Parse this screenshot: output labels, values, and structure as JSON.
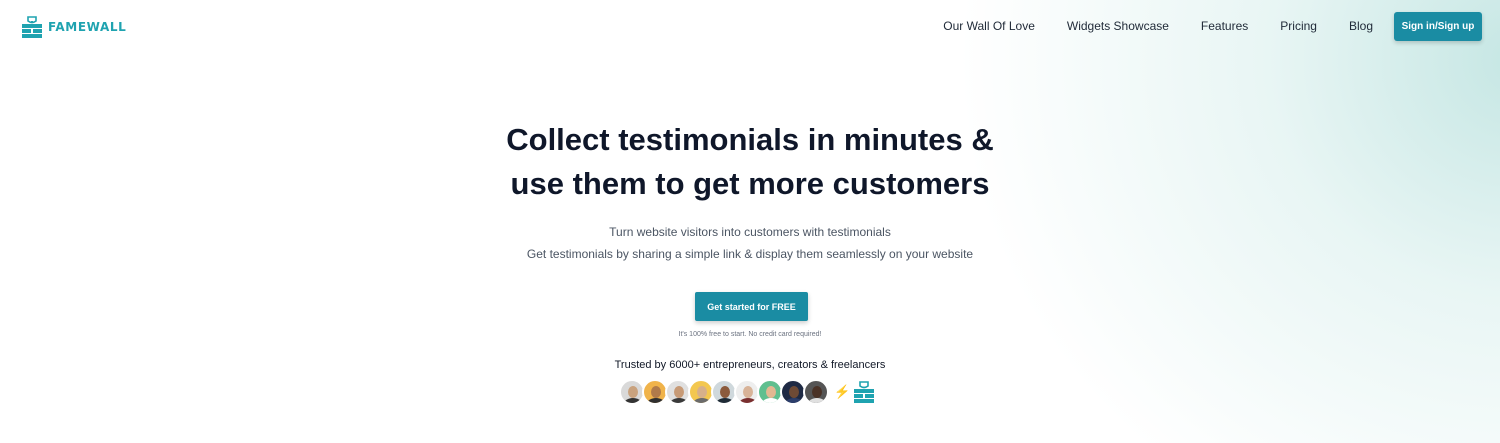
{
  "header": {
    "brand": "FAMEWALL",
    "nav": [
      {
        "label": "Our Wall Of Love"
      },
      {
        "label": "Widgets Showcase"
      },
      {
        "label": "Features"
      },
      {
        "label": "Pricing"
      },
      {
        "label": "Blog"
      }
    ],
    "signin_label": "Sign in/Sign up"
  },
  "hero": {
    "headline_line1": "Collect testimonials in minutes &",
    "headline_line2": "use them to get more customers",
    "sub_line1": "Turn website visitors into customers with testimonials",
    "sub_line2": "Get testimonials by sharing a simple link & display them seamlessly on your website",
    "cta_label": "Get started for FREE",
    "note": "It's 100% free to start. No credit card required!",
    "trusted_text": "Trusted by 6000+ entrepreneurs, creators & freelancers"
  },
  "avatars": [
    {
      "name": "avatar-1",
      "skin": "#c9a27e",
      "bg": "#d9d9d9",
      "shirt": "#333333"
    },
    {
      "name": "avatar-2",
      "skin": "#b07a4a",
      "bg": "#f0b34a",
      "shirt": "#2f2f2f"
    },
    {
      "name": "avatar-3",
      "skin": "#c79a76",
      "bg": "#e0e0e0",
      "shirt": "#3a3a3a"
    },
    {
      "name": "avatar-4",
      "skin": "#d7b08a",
      "bg": "#f3c74f",
      "shirt": "#6b6b6b"
    },
    {
      "name": "avatar-5",
      "skin": "#8b5a3c",
      "bg": "#cfd8dc",
      "shirt": "#1f2b36"
    },
    {
      "name": "avatar-6",
      "skin": "#d8b398",
      "bg": "#eeeeee",
      "shirt": "#7a2f2f"
    },
    {
      "name": "avatar-7",
      "skin": "#e2b892",
      "bg": "#5fbf8f",
      "shirt": "#ffffff"
    },
    {
      "name": "avatar-8",
      "skin": "#6e4a35",
      "bg": "#1f2a44",
      "shirt": "#2c3e6b"
    },
    {
      "name": "avatar-9",
      "skin": "#4a3226",
      "bg": "#555555",
      "shirt": "#e0e0e0"
    }
  ],
  "icons": {
    "bolt": "lightning-bolt-icon",
    "brand_icon": "famewall-logo-icon"
  },
  "colors": {
    "accent": "#1a8ca3",
    "brand": "#1fa3b0",
    "bolt": "#f5b400"
  }
}
